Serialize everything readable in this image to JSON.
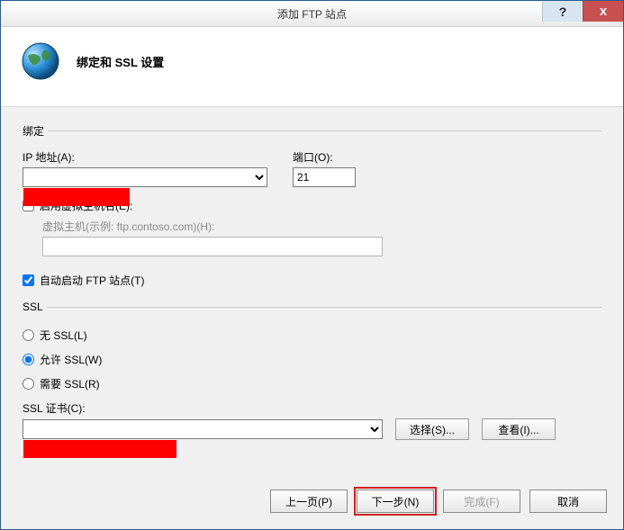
{
  "window": {
    "title": "添加 FTP 站点",
    "help_symbol": "?",
    "close_symbol": "x"
  },
  "header": {
    "heading": "绑定和 SSL 设置"
  },
  "binding": {
    "legend": "绑定",
    "ip_label": "IP 地址(A):",
    "ip_value": "",
    "port_label": "端口(O):",
    "port_value": "21",
    "enable_vhost_label": "启用虚拟主机名(E):",
    "enable_vhost_checked": false,
    "vhost_label": "虚拟主机(示例: ftp.contoso.com)(H):",
    "vhost_value": ""
  },
  "autostart": {
    "label": "自动启动 FTP 站点(T)",
    "checked": true
  },
  "ssl": {
    "legend": "SSL",
    "no_ssl_label": "无 SSL(L)",
    "allow_ssl_label": "允许 SSL(W)",
    "require_ssl_label": "需要 SSL(R)",
    "selected": "allow",
    "cert_label": "SSL 证书(C):",
    "cert_value": "",
    "select_btn": "选择(S)...",
    "view_btn": "查看(I)..."
  },
  "footer": {
    "prev": "上一页(P)",
    "next": "下一步(N)",
    "finish": "完成(F)",
    "cancel": "取消"
  }
}
